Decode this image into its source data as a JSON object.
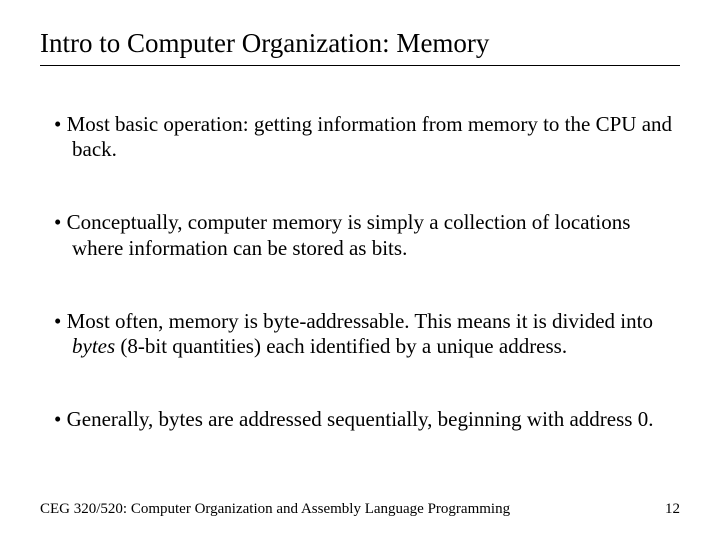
{
  "title": "Intro to Computer Organization: Memory",
  "bullets": [
    {
      "text": "Most basic operation: getting information from memory to the CPU and back."
    },
    {
      "text": "Conceptually, computer memory is simply a collection of locations where information can be stored as bits."
    },
    {
      "pre": "Most often, memory is byte-addressable. This means it is divided into ",
      "italic": "bytes",
      "post": " (8-bit quantities) each identified by a unique address."
    },
    {
      "text": "Generally, bytes are addressed sequentially, beginning with address 0."
    }
  ],
  "footer": {
    "course": "CEG 320/520: Computer Organization and Assembly Language Programming",
    "page": "12"
  }
}
